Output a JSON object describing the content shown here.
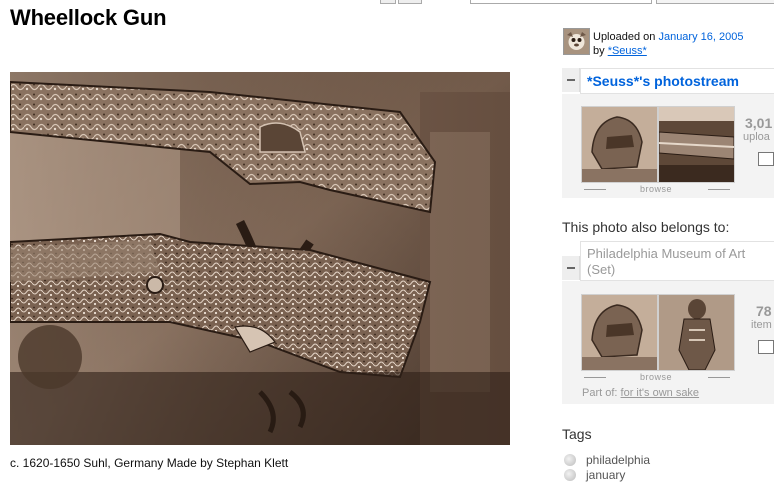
{
  "page": {
    "title": "Wheellock Gun",
    "caption": "c. 1620-1650 Suhl, Germany Made by Stephan Klett"
  },
  "uploader": {
    "prefix": "Uploaded on",
    "date": "January 16, 2005",
    "by": "by",
    "name": "*Seuss*"
  },
  "photostream": {
    "title": "*Seuss*'s photostream",
    "count": "3,01",
    "count_label": "uploa",
    "browse_label": "browse"
  },
  "belongs": {
    "heading": "This photo also belongs to:",
    "set_title": "Philadelphia Museum of Art (Set)",
    "count": "78",
    "count_label": "item",
    "browse_label": "browse",
    "part_of_label": "Part of:",
    "part_of_link": "for it's own sake"
  },
  "tags": {
    "heading": "Tags",
    "items": [
      "philadelphia",
      "january"
    ]
  },
  "colors": {
    "link": "#0063dc",
    "sepia_dark": "#3a2a20",
    "sepia_light": "#c9b3a0"
  }
}
